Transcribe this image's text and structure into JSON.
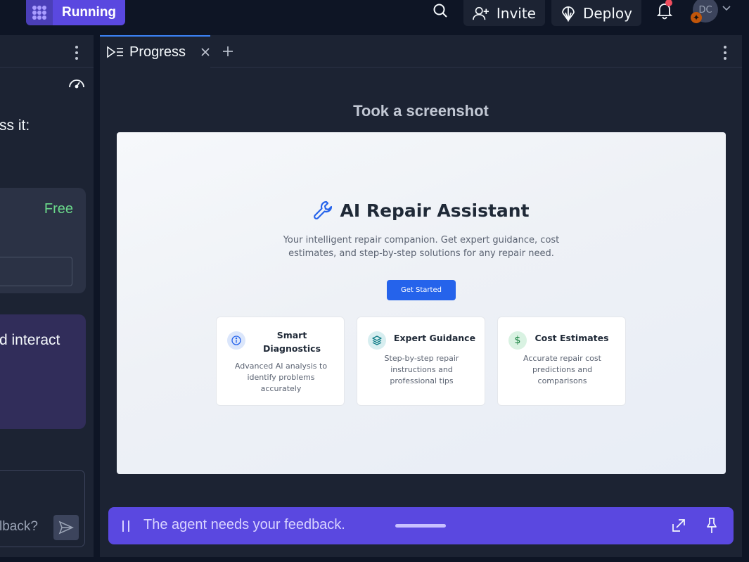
{
  "topbar": {
    "status_label": "Running",
    "invite_label": "Invite",
    "deploy_label": "Deploy",
    "avatar_initials": "DC"
  },
  "left_panel": {
    "text_1": "ss it:",
    "free_label": "Free",
    "text_2": "d interact",
    "input_placeholder": "lback?"
  },
  "tabs": [
    {
      "label": "Progress"
    }
  ],
  "progress": {
    "heading": "Took a screenshot"
  },
  "screenshot": {
    "app_title": "AI Repair Assistant",
    "description_line1": "Your intelligent repair companion. Get expert guidance, cost",
    "description_line2": "estimates, and step-by-step solutions for any repair need.",
    "cta_label": "Get Started",
    "features": [
      {
        "title_line1": "Smart",
        "title_line2": "Diagnostics",
        "desc_line1": "Advanced AI analysis to",
        "desc_line2": "identify problems",
        "desc_line3": "accurately",
        "icon": "info-icon"
      },
      {
        "title": "Expert Guidance",
        "desc_line1": "Step-by-step repair",
        "desc_line2": "instructions and",
        "desc_line3": "professional tips",
        "icon": "layers-icon"
      },
      {
        "title": "Cost Estimates",
        "desc_line1": "Accurate repair cost",
        "desc_line2": "predictions and",
        "desc_line3": "comparisons",
        "icon": "dollar-icon"
      }
    ]
  },
  "feedback": {
    "message": "The agent needs your feedback."
  },
  "colors": {
    "accent": "#5a48e0",
    "panel": "#1c2333",
    "background": "#0e1525",
    "free_green": "#6ad88a",
    "cta_blue": "#2563eb"
  }
}
